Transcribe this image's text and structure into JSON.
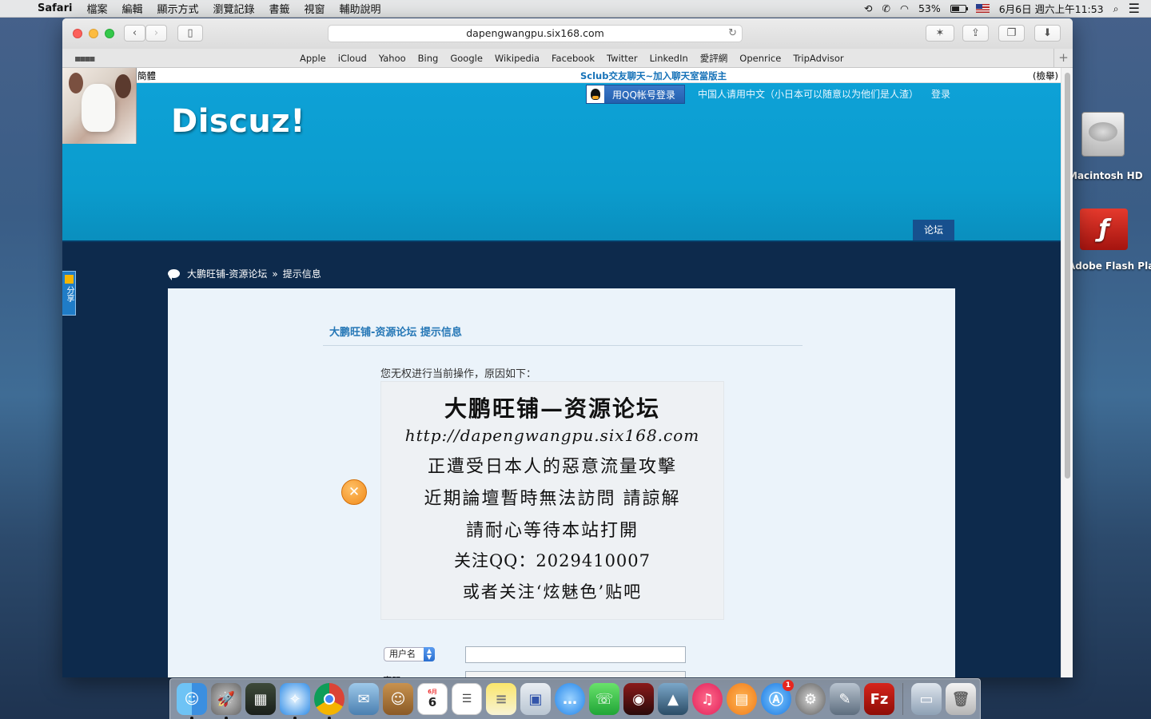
{
  "menubar": {
    "app_name": "Safari",
    "items": [
      "檔案",
      "編輯",
      "顯示方式",
      "瀏覽記錄",
      "書籤",
      "視窗",
      "輔助說明"
    ],
    "battery": "53%",
    "datetime": "6月6日 週六上午11:53"
  },
  "browser": {
    "url": "dapengwangpu.six168.com",
    "favorites": [
      "Apple",
      "iCloud",
      "Yahoo",
      "Bing",
      "Google",
      "Wikipedia",
      "Facebook",
      "Twitter",
      "LinkedIn",
      "愛評網",
      "Openrice",
      "TripAdvisor"
    ]
  },
  "page": {
    "top_strip": {
      "left": "簡體",
      "center": "Sclub交友聊天~加入聊天室當版主",
      "right": "(檢舉)"
    },
    "logo": "Discuz!",
    "qq_login": "用QQ帐号登录",
    "notice_link": "中国人请用中文（小日本可以随意以为他们是人渣）",
    "login_link": "登录",
    "nav_tab": "论坛",
    "share_tab": "分享",
    "breadcrumb": {
      "forum": "大鹏旺铺-资源论坛",
      "separator": "»",
      "current": "提示信息"
    },
    "content": {
      "title": "大鹏旺铺-资源论坛 提示信息",
      "reason": "您无权进行当前操作，原因如下：",
      "notice_lines": [
        "大鹏旺铺—资源论坛",
        "http://dapengwangpu.six168.com",
        "正遭受日本人的惡意流量攻擊",
        "近期論壇暫時無法訪問 請諒解",
        "請耐心等待本站打開",
        "关注QQ：2029410007",
        "或者关注‘炫魅色’贴吧"
      ],
      "username_select": "用户名",
      "username_value": "",
      "password_label": "密码",
      "password_value": ""
    }
  },
  "desktop": {
    "icons": [
      "Macintosh HD",
      "Adobe Flash Player Installer"
    ]
  },
  "dock": {
    "appstore_badge": "1",
    "calendar_day": "6"
  }
}
